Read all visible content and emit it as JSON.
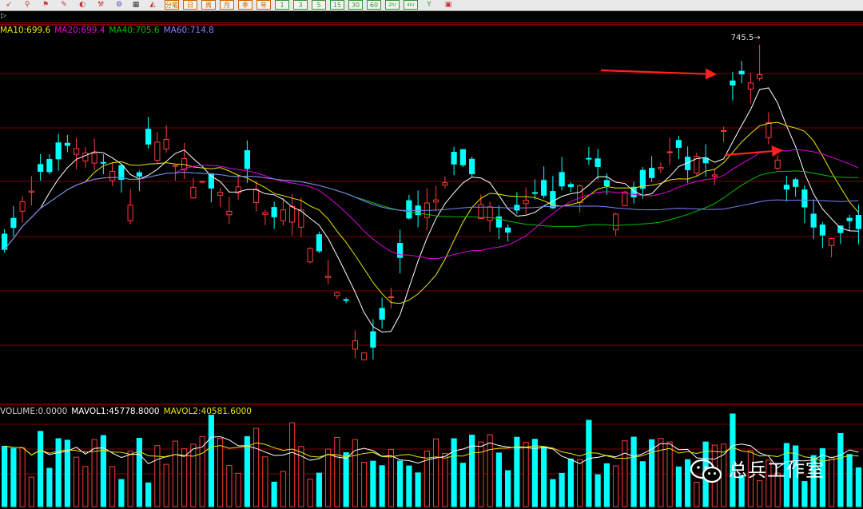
{
  "toolbar": {
    "buttons": [
      {
        "label": "",
        "icon": "pointer-icon",
        "color": "#c33"
      },
      {
        "label": "",
        "icon": "zoom-icon",
        "color": "#c33"
      },
      {
        "label": "",
        "icon": "flag-icon",
        "color": "#c33"
      },
      {
        "label": "",
        "icon": "pen-icon",
        "color": "#c33"
      },
      {
        "label": "",
        "icon": "paint-icon",
        "color": "#c33"
      },
      {
        "label": "",
        "icon": "tool-icon",
        "color": "#c33"
      },
      {
        "label": "",
        "icon": "settings-icon",
        "color": "#44c"
      },
      {
        "label": "",
        "icon": "grid-icon",
        "color": "#333"
      },
      {
        "label": "",
        "icon": "chart-icon",
        "color": "#c33"
      },
      {
        "label": "分笔",
        "icon": "",
        "color": "#c60"
      },
      {
        "label": "日",
        "icon": "",
        "color": "#c60"
      },
      {
        "label": "周",
        "icon": "",
        "color": "#c60"
      },
      {
        "label": "月",
        "icon": "",
        "color": "#c60"
      },
      {
        "label": "季",
        "icon": "",
        "color": "#c60"
      },
      {
        "label": "年",
        "icon": "",
        "color": "#c60"
      },
      {
        "label": "1",
        "icon": "",
        "color": "#393"
      },
      {
        "label": "3",
        "icon": "",
        "color": "#393"
      },
      {
        "label": "5",
        "icon": "",
        "color": "#393"
      },
      {
        "label": "15",
        "icon": "",
        "color": "#393"
      },
      {
        "label": "30",
        "icon": "",
        "color": "#393"
      },
      {
        "label": "60",
        "icon": "",
        "color": "#393"
      },
      {
        "label": "2hr",
        "icon": "",
        "color": "#393"
      },
      {
        "label": "4hr",
        "icon": "",
        "color": "#393"
      },
      {
        "label": "",
        "icon": "custom-period-icon",
        "color": "#393"
      },
      {
        "label": "",
        "icon": "calendar-icon",
        "color": "#c33"
      }
    ]
  },
  "subbar_arrow": "▷",
  "legend_top": [
    {
      "text": "MA10:699.6",
      "color": "#e8e800"
    },
    {
      "text": "MA20:699.4",
      "color": "#e000e0"
    },
    {
      "text": "MA40:705.6",
      "color": "#00c000"
    },
    {
      "text": "MA60:714.8",
      "color": "#8080ff"
    }
  ],
  "legend_vol": [
    {
      "text": "VOLUME:0.0000",
      "color": "#d0d0d0"
    },
    {
      "text": "MAVOL1:45778.8000",
      "color": "#ffffff"
    },
    {
      "text": "MAVOL2:40581.6000",
      "color": "#e8e800"
    }
  ],
  "peak_label": "745.5→",
  "watermark": "总兵工作室",
  "colors": {
    "up": "#ff3c3c",
    "down": "#00ffff",
    "ma5": "#ffffff",
    "ma10": "#e8e800",
    "ma20": "#e000e0",
    "ma40": "#00c000",
    "ma60": "#8080ff",
    "grid": "#800000",
    "arrow": "#ff2020"
  },
  "chart_data": {
    "type": "candlestick",
    "title": "",
    "ylim": [
      658,
      750
    ],
    "candle_count": 96,
    "peak_value": 745.5,
    "ma_last": {
      "MA10": 699.6,
      "MA20": 699.4,
      "MA40": 705.6,
      "MA60": 714.8
    },
    "volume_last": {
      "VOLUME": 0.0,
      "MAVOL1": 45778.8,
      "MAVOL2": 40581.6
    },
    "anchors": [
      [
        0,
        698.0
      ],
      [
        7,
        722.0
      ],
      [
        10,
        718.0
      ],
      [
        14,
        708.0
      ],
      [
        17,
        724.0
      ],
      [
        21,
        712.0
      ],
      [
        25,
        706.0
      ],
      [
        27,
        712.0
      ],
      [
        30,
        703.0
      ],
      [
        32,
        706.0
      ],
      [
        36,
        690.0
      ],
      [
        40,
        670.0
      ],
      [
        42,
        675.0
      ],
      [
        45,
        700.0
      ],
      [
        48,
        707.0
      ],
      [
        51,
        717.0
      ],
      [
        53,
        708.0
      ],
      [
        55,
        700.0
      ],
      [
        58,
        706.0
      ],
      [
        62,
        708.0
      ],
      [
        65,
        716.0
      ],
      [
        68,
        706.0
      ],
      [
        71,
        713.0
      ],
      [
        74,
        718.0
      ],
      [
        77,
        716.0
      ],
      [
        79,
        713.0
      ],
      [
        81,
        737.0
      ],
      [
        84,
        739.0
      ],
      [
        86,
        715.0
      ],
      [
        89,
        705.0
      ],
      [
        92,
        695.0
      ],
      [
        94,
        701.0
      ],
      [
        95,
        703.0
      ]
    ]
  }
}
